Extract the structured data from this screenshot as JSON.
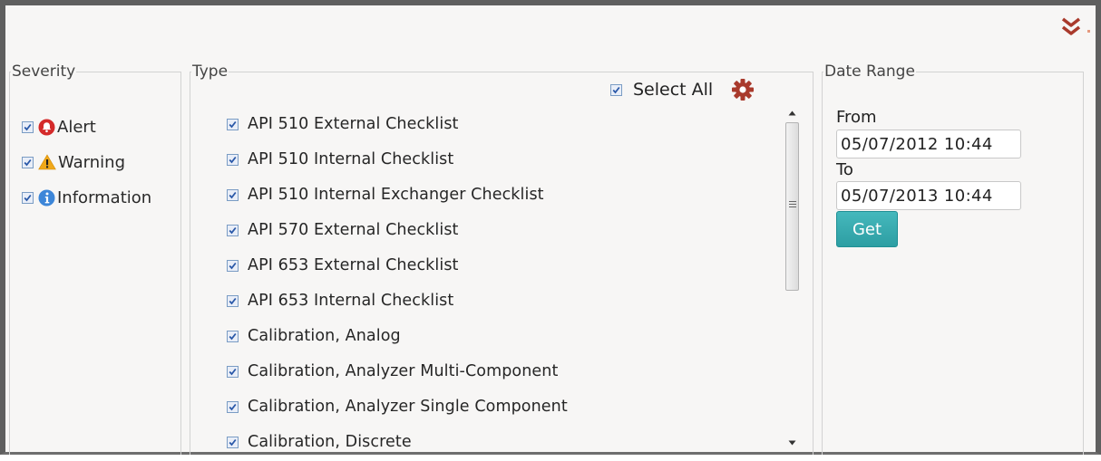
{
  "colors": {
    "accent_red": "#a93a2c",
    "checkbox_blue": "#2a58a8",
    "button_teal": "#33a6ab",
    "alert_red": "#d42a2a",
    "warning_amber": "#f0a81a",
    "info_blue": "#3d86d8"
  },
  "header": {
    "collapse_icon": "double-chevron-down-icon"
  },
  "severity": {
    "legend": "Severity",
    "items": [
      {
        "label": "Alert",
        "checked": true,
        "icon": "alert-icon"
      },
      {
        "label": "Warning",
        "checked": true,
        "icon": "warning-icon"
      },
      {
        "label": "Information",
        "checked": true,
        "icon": "information-icon"
      }
    ]
  },
  "type": {
    "legend": "Type",
    "select_all_label": "Select All",
    "select_all_checked": true,
    "settings_icon": "gear-icon",
    "items": [
      {
        "label": "API 510 External Checklist",
        "checked": true
      },
      {
        "label": "API 510 Internal Checklist",
        "checked": true
      },
      {
        "label": "API 510 Internal Exchanger Checklist",
        "checked": true
      },
      {
        "label": "API 570 External Checklist",
        "checked": true
      },
      {
        "label": "API 653 External Checklist",
        "checked": true
      },
      {
        "label": "API 653 Internal Checklist",
        "checked": true
      },
      {
        "label": "Calibration, Analog",
        "checked": true
      },
      {
        "label": "Calibration, Analyzer Multi-Component",
        "checked": true
      },
      {
        "label": "Calibration, Analyzer Single Component",
        "checked": true
      },
      {
        "label": "Calibration, Discrete",
        "checked": true
      }
    ]
  },
  "date_range": {
    "legend": "Date Range",
    "from_label": "From",
    "from_value": "05/07/2012 10:44",
    "to_label": "To",
    "to_value": "05/07/2013 10:44",
    "get_label": "Get"
  }
}
